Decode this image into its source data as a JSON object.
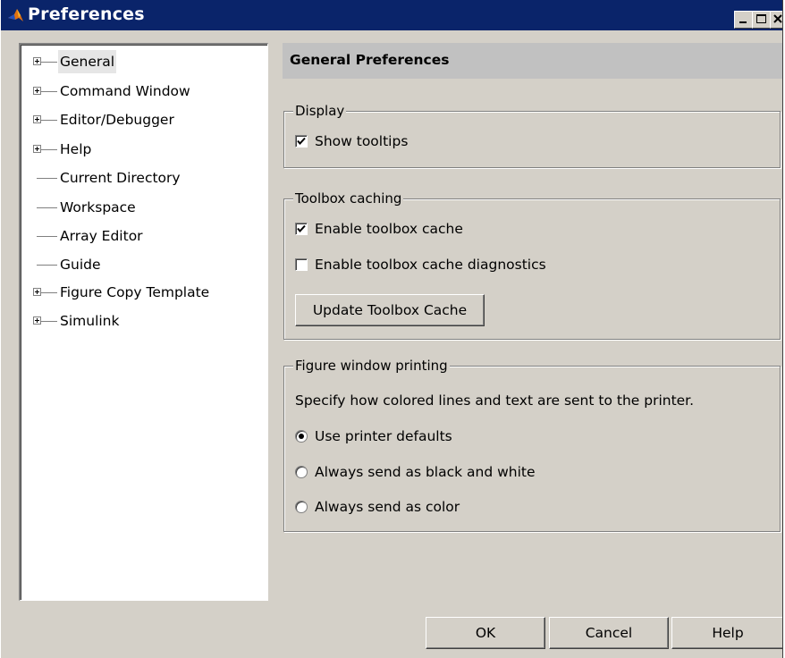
{
  "window": {
    "title": "Preferences"
  },
  "tree": {
    "items": [
      {
        "label": "General",
        "expandable": true,
        "selected": true
      },
      {
        "label": "Command Window",
        "expandable": true
      },
      {
        "label": "Editor/Debugger",
        "expandable": true
      },
      {
        "label": "Help",
        "expandable": true
      },
      {
        "label": "Current Directory",
        "expandable": false
      },
      {
        "label": "Workspace",
        "expandable": false
      },
      {
        "label": "Array Editor",
        "expandable": false
      },
      {
        "label": "Guide",
        "expandable": false
      },
      {
        "label": "Figure Copy Template",
        "expandable": true
      },
      {
        "label": "Simulink",
        "expandable": true
      }
    ]
  },
  "panel": {
    "header": "General Preferences",
    "display": {
      "title": "Display",
      "show_tooltips": {
        "label": "Show tooltips",
        "checked": true
      }
    },
    "toolbox": {
      "title": "Toolbox caching",
      "enable_cache": {
        "label": "Enable toolbox cache",
        "checked": true
      },
      "enable_diagnostics": {
        "label": "Enable toolbox cache diagnostics",
        "checked": false
      },
      "update_button": "Update Toolbox Cache"
    },
    "printing": {
      "title": "Figure window printing",
      "description": "Specify how colored lines and text are sent to the printer.",
      "options": [
        {
          "label": "Use printer defaults",
          "selected": true
        },
        {
          "label": "Always send as black and white",
          "selected": false
        },
        {
          "label": "Always send as color",
          "selected": false
        }
      ]
    }
  },
  "buttons": {
    "ok": "OK",
    "cancel": "Cancel",
    "help": "Help"
  },
  "icons": {
    "app": "matlab-logo-icon",
    "minimize": "minimize-icon",
    "maximize": "maximize-icon",
    "close": "close-icon"
  },
  "colors": {
    "titlebar": "#0a246a",
    "face": "#d4d0c8",
    "header": "#c1c1c1"
  }
}
